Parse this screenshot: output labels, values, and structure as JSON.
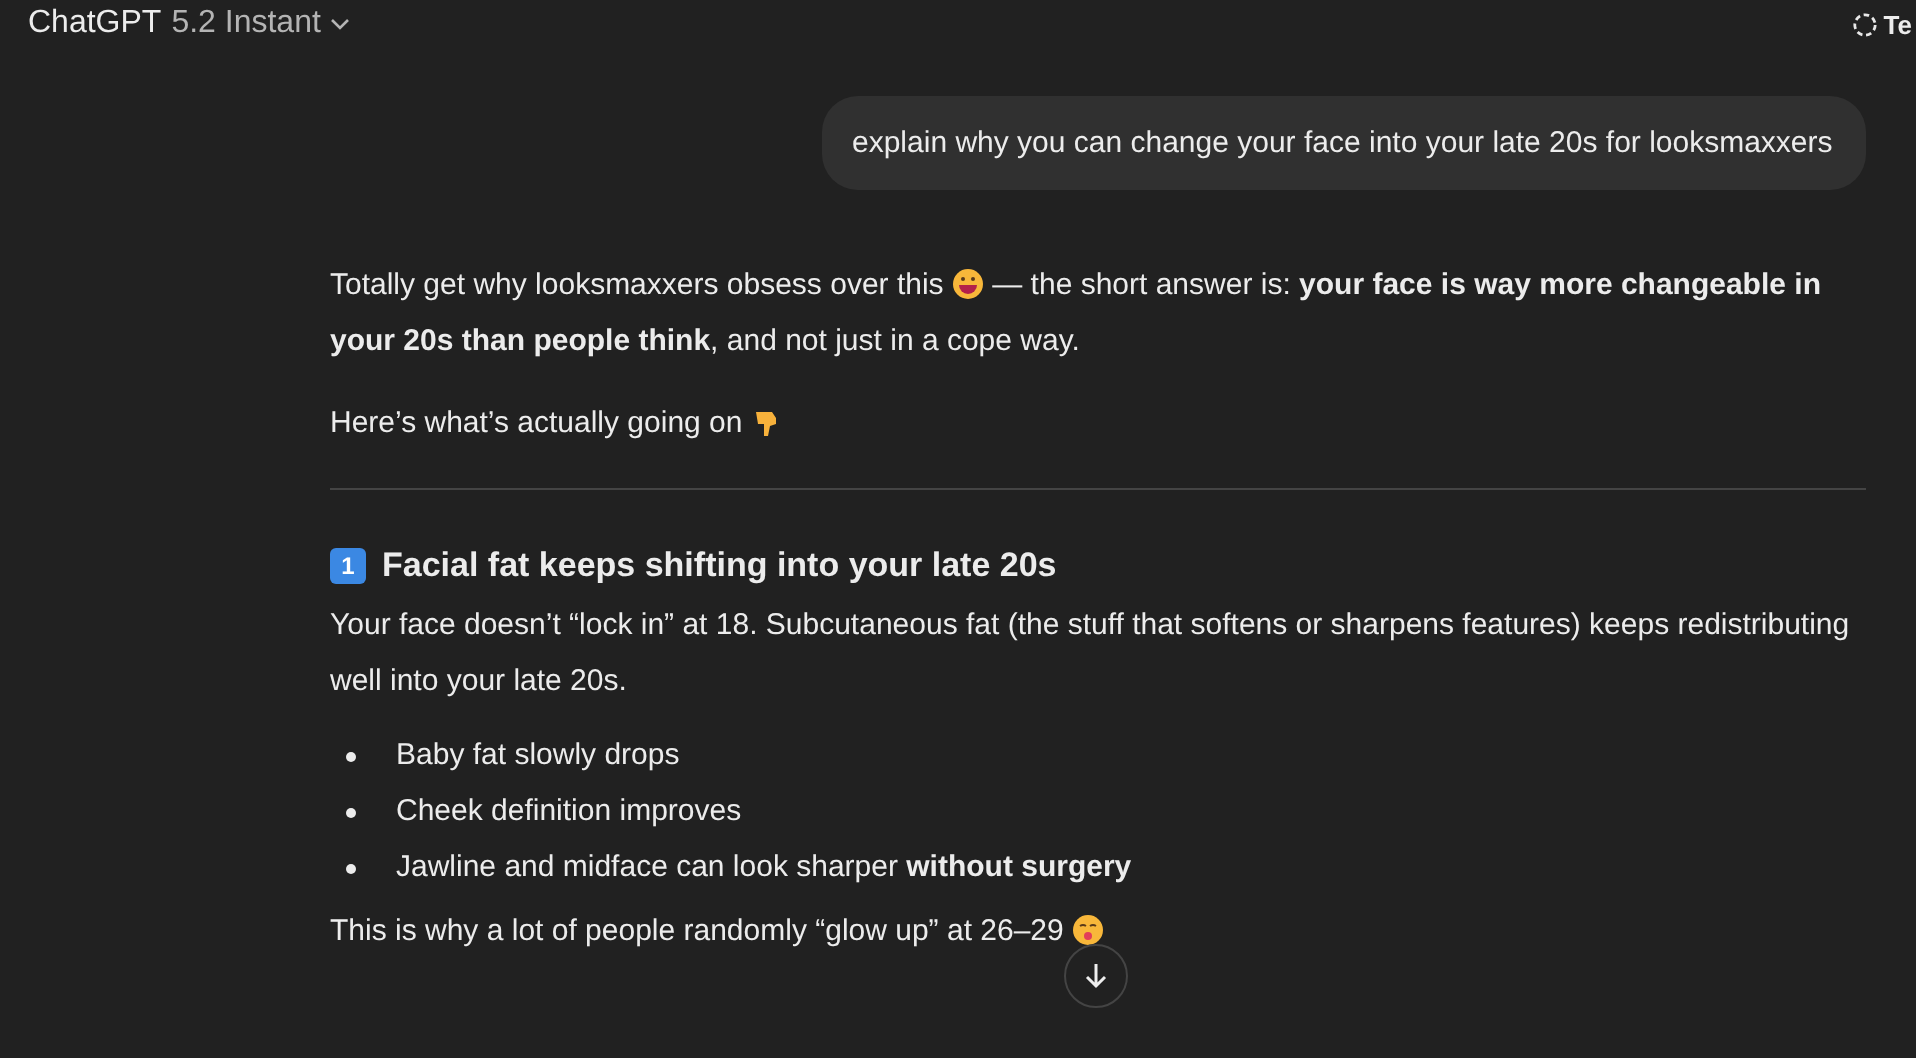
{
  "header": {
    "title": "ChatGPT",
    "model": "5.2 Instant",
    "right_label": "Te"
  },
  "user_message": "explain why you can change your face into your late 20s for looksmaxxers",
  "response": {
    "intro": "Totally get why looksmaxxers obsess over this",
    "intro_rest": "— the short answer is: **your face is way more changeable in your 20s than people think**, and not just in a cope way.",
    "lead": "Here’s what’s actually going on",
    "section": {
      "number": "1",
      "title": "Facial fat keeps shifting into your late 20s",
      "body": "Your face doesn’t “lock in” at 18. Subcutaneous fat (the stuff that softens or sharpens features) keeps redistributing well into your late 20s.",
      "bullets": [
        "Baby fat slowly drops",
        "Cheek definition improves",
        "Jawline and midface can look sharper **without surgery**"
      ],
      "after": "This is why a lot of people randomly “glow up” at 26–29"
    }
  }
}
